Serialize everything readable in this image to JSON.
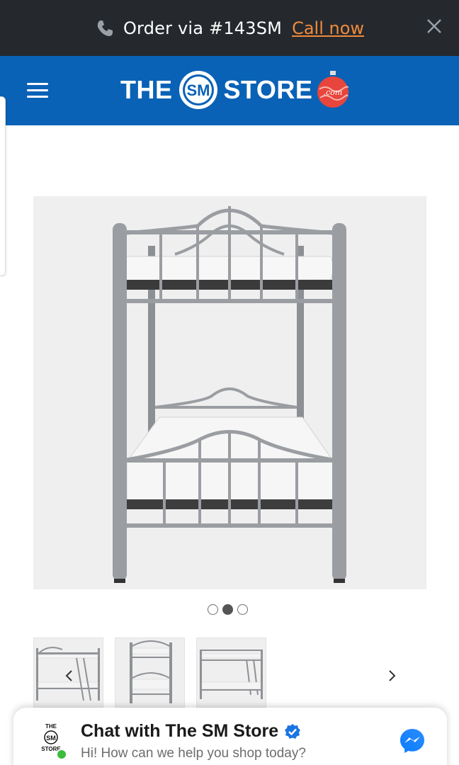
{
  "promo": {
    "text": "Order via #143SM",
    "link_label": "Call now",
    "icon": "phone-icon",
    "close_icon": "close-icon"
  },
  "header": {
    "menu_icon": "hamburger-menu-icon",
    "logo": {
      "word_left": "THE",
      "badge": "SM",
      "word_right": "STORE",
      "ornament": ".com"
    },
    "background": "#0a62b6"
  },
  "gallery": {
    "dots_total": 3,
    "active_dot": 2,
    "thumbnails": [
      "bunk-bed-side-view",
      "bunk-bed-front-view",
      "bunk-bed-angle-view"
    ],
    "prev_icon": "chevron-left-icon",
    "next_icon": "chevron-right-icon"
  },
  "chat": {
    "title": "Chat with The SM Store",
    "subtitle": "Hi! How can we help you shop today?",
    "avatar": {
      "line1": "THE",
      "badge": "SM",
      "line2": "STORE"
    },
    "verified_icon": "verified-badge-icon",
    "messenger_icon": "messenger-icon",
    "status_color": "#3cbb3c"
  },
  "colors": {
    "promo_bg": "#25292e",
    "link": "#f08a3c",
    "brand_blue": "#0a62b6",
    "ornament_red": "#e8453c"
  }
}
